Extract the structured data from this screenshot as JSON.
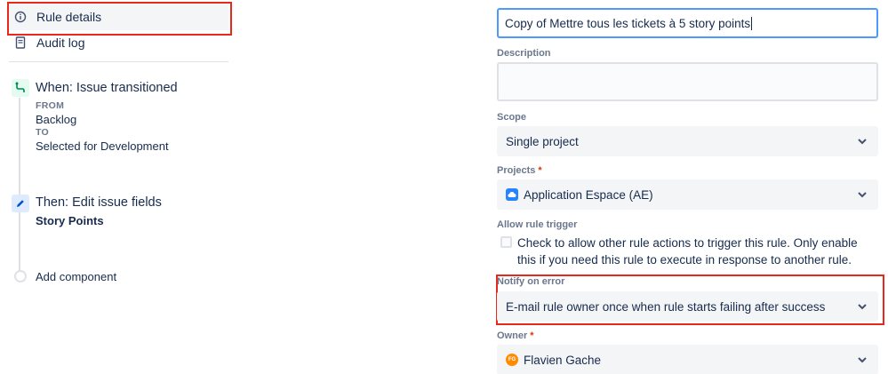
{
  "nav": {
    "rule_details": "Rule details",
    "audit_log": "Audit log"
  },
  "timeline": {
    "when": {
      "title": "When: Issue transitioned",
      "from_label": "FROM",
      "from_value": "Backlog",
      "to_label": "TO",
      "to_value": "Selected for Development"
    },
    "then": {
      "title": "Then: Edit issue fields",
      "field": "Story Points"
    },
    "add_component": "Add component"
  },
  "form": {
    "name_value": "Copy of Mettre tous les tickets à 5 story points",
    "description_label": "Description",
    "description_value": "",
    "scope_label": "Scope",
    "scope_value": "Single project",
    "projects_label": "Projects",
    "projects_value": "Application Espace (AE)",
    "allow_trigger_label": "Allow rule trigger",
    "allow_trigger_text": "Check to allow other rule actions to trigger this rule. Only enable this if you need this rule to execute in response to another rule.",
    "notify_label": "Notify on error",
    "notify_value": "E-mail rule owner once when rule starts failing after success",
    "owner_label": "Owner",
    "owner_value": "Flavien Gache",
    "owner_initials": "FG",
    "required_marker": "*"
  },
  "icons": {
    "info": "info-icon",
    "audit": "document-icon",
    "transition": "transition-icon",
    "edit": "pencil-icon",
    "chevron": "chevron-down-icon"
  },
  "colors": {
    "highlight": "#E8281B",
    "focus": "#4C9AFF",
    "required": "#DE350B"
  }
}
